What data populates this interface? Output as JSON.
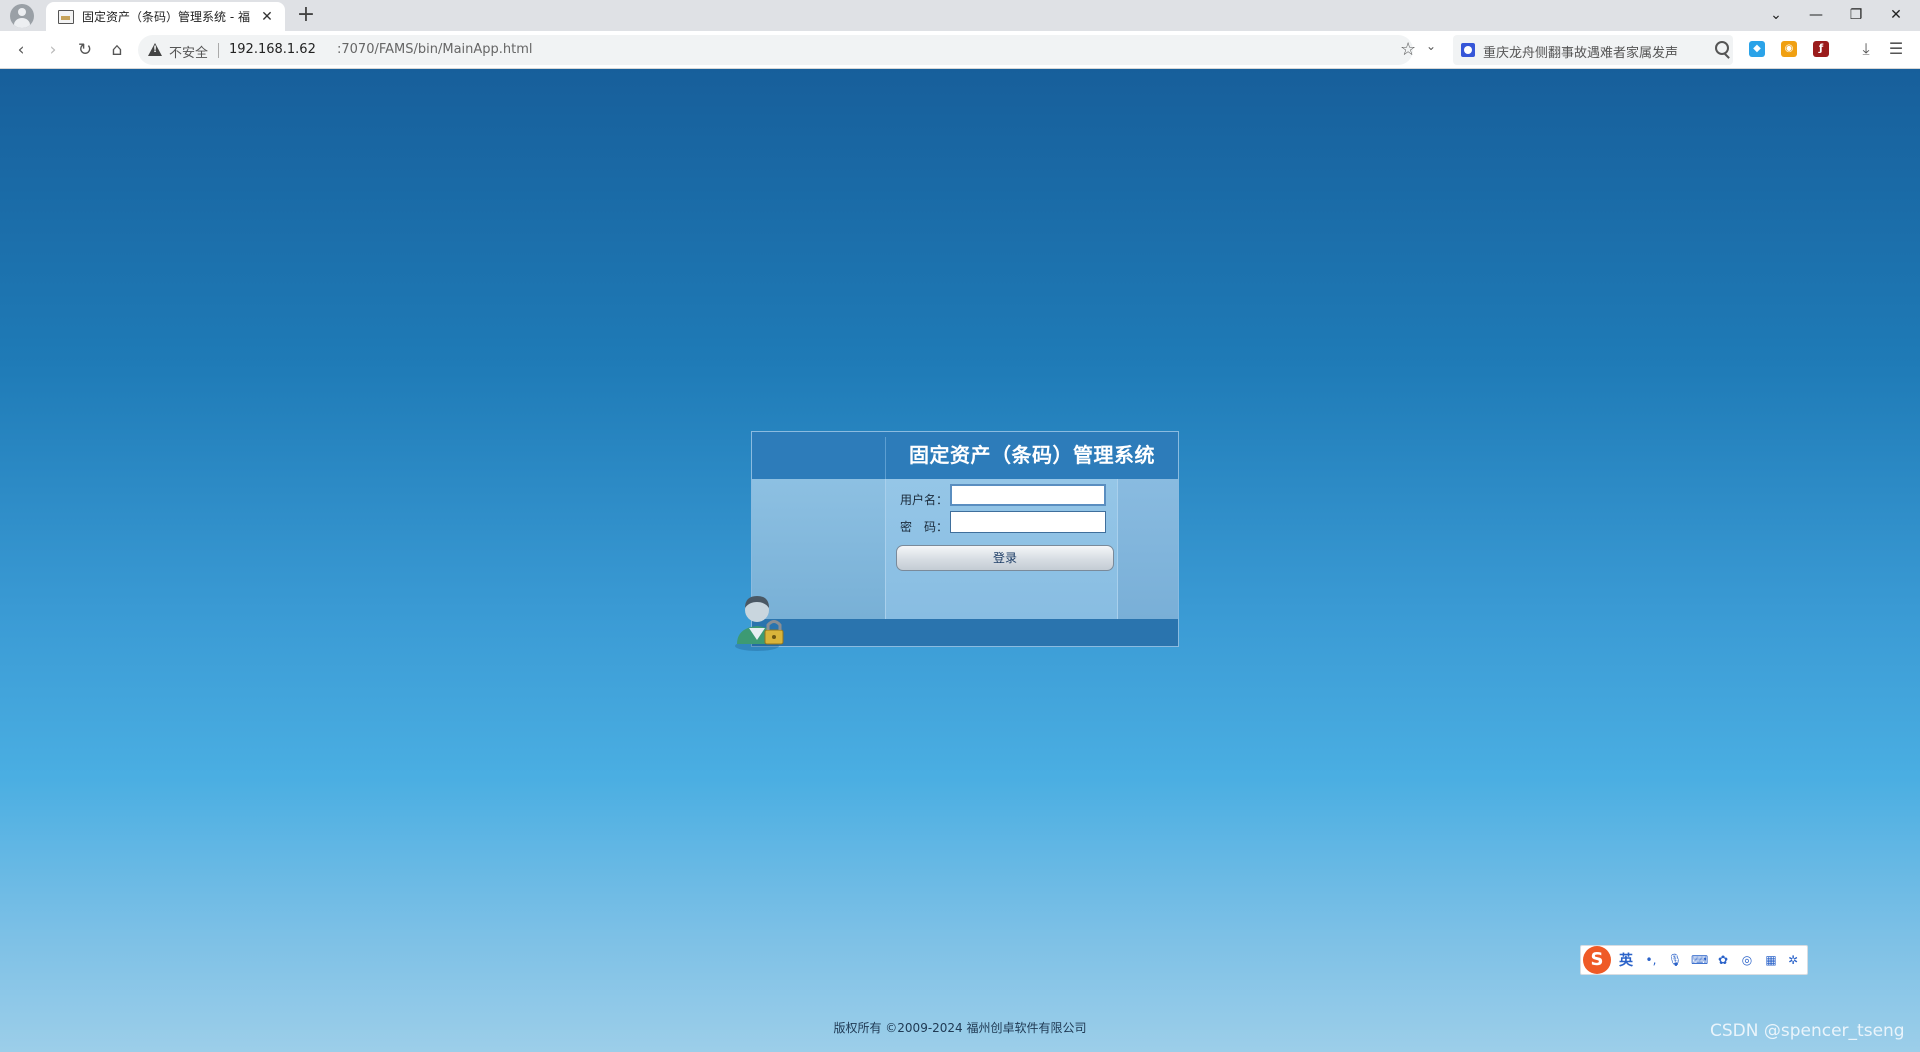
{
  "browser": {
    "tab_title": "固定资产（条码）管理系统 - 福",
    "tab_close": "✕",
    "new_tab": "+",
    "window_controls": {
      "dropdown": "⌄",
      "minimize": "—",
      "restore": "❐",
      "close": "✕"
    },
    "security_label": "不安全",
    "url_host": "192.168.1.62",
    "url_path": ":7070/FAMS/bin/MainApp.html",
    "search_query": "重庆龙舟侧翻事故遇难者家属发声",
    "icons": [
      "back-icon",
      "forward-icon",
      "reload-icon",
      "home-icon",
      "warning-icon",
      "star-icon",
      "search-icon",
      "download-icon",
      "menu-icon"
    ]
  },
  "login": {
    "title": "固定资产（条码）管理系统",
    "username_label": "用户名：",
    "username_value": "",
    "password_label": "密　码：",
    "password_value": "",
    "submit_label": "登录"
  },
  "footer": {
    "copyright": "版权所有 ©2009-2024 福州创卓软件有限公司",
    "watermark": "CSDN @spencer_tseng"
  },
  "ime": {
    "logo": "S",
    "mode": "英"
  },
  "colors": {
    "page_top": "#175f9b",
    "page_bottom": "#9ccee9",
    "login_header": "#2d7cba",
    "login_panel": "#95c6e7"
  }
}
